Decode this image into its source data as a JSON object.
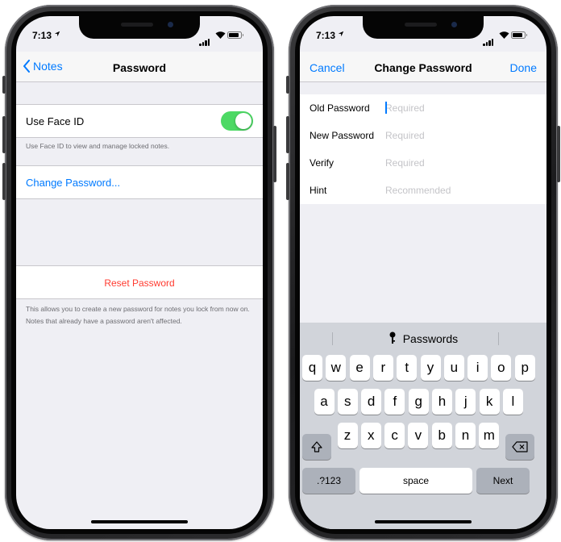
{
  "left_phone": {
    "status": {
      "time": "7:13"
    },
    "nav": {
      "back_label": "Notes",
      "title": "Password"
    },
    "face_id": {
      "label": "Use Face ID",
      "enabled": true,
      "footer": "Use Face ID to view and manage locked notes."
    },
    "change_password_label": "Change Password...",
    "reset_password_label": "Reset Password",
    "reset_footer": "This allows you to create a new password for notes you lock from now on. Notes that already have a password aren't affected."
  },
  "right_phone": {
    "status": {
      "time": "7:13"
    },
    "nav": {
      "cancel_label": "Cancel",
      "title": "Change Password",
      "done_label": "Done"
    },
    "fields": [
      {
        "label": "Old Password",
        "placeholder": "Required"
      },
      {
        "label": "New Password",
        "placeholder": "Required"
      },
      {
        "label": "Verify",
        "placeholder": "Required"
      },
      {
        "label": "Hint",
        "placeholder": "Recommended"
      }
    ],
    "keyboard": {
      "suggestion": "Passwords",
      "row1": [
        "q",
        "w",
        "e",
        "r",
        "t",
        "y",
        "u",
        "i",
        "o",
        "p"
      ],
      "row2": [
        "a",
        "s",
        "d",
        "f",
        "g",
        "h",
        "j",
        "k",
        "l"
      ],
      "row3": [
        "z",
        "x",
        "c",
        "v",
        "b",
        "n",
        "m"
      ],
      "numbers_label": ".?123",
      "space_label": "space",
      "next_label": "Next"
    }
  },
  "colors": {
    "accent": "#007aff",
    "destructive": "#ff3b30",
    "toggle_on": "#4cd964"
  }
}
